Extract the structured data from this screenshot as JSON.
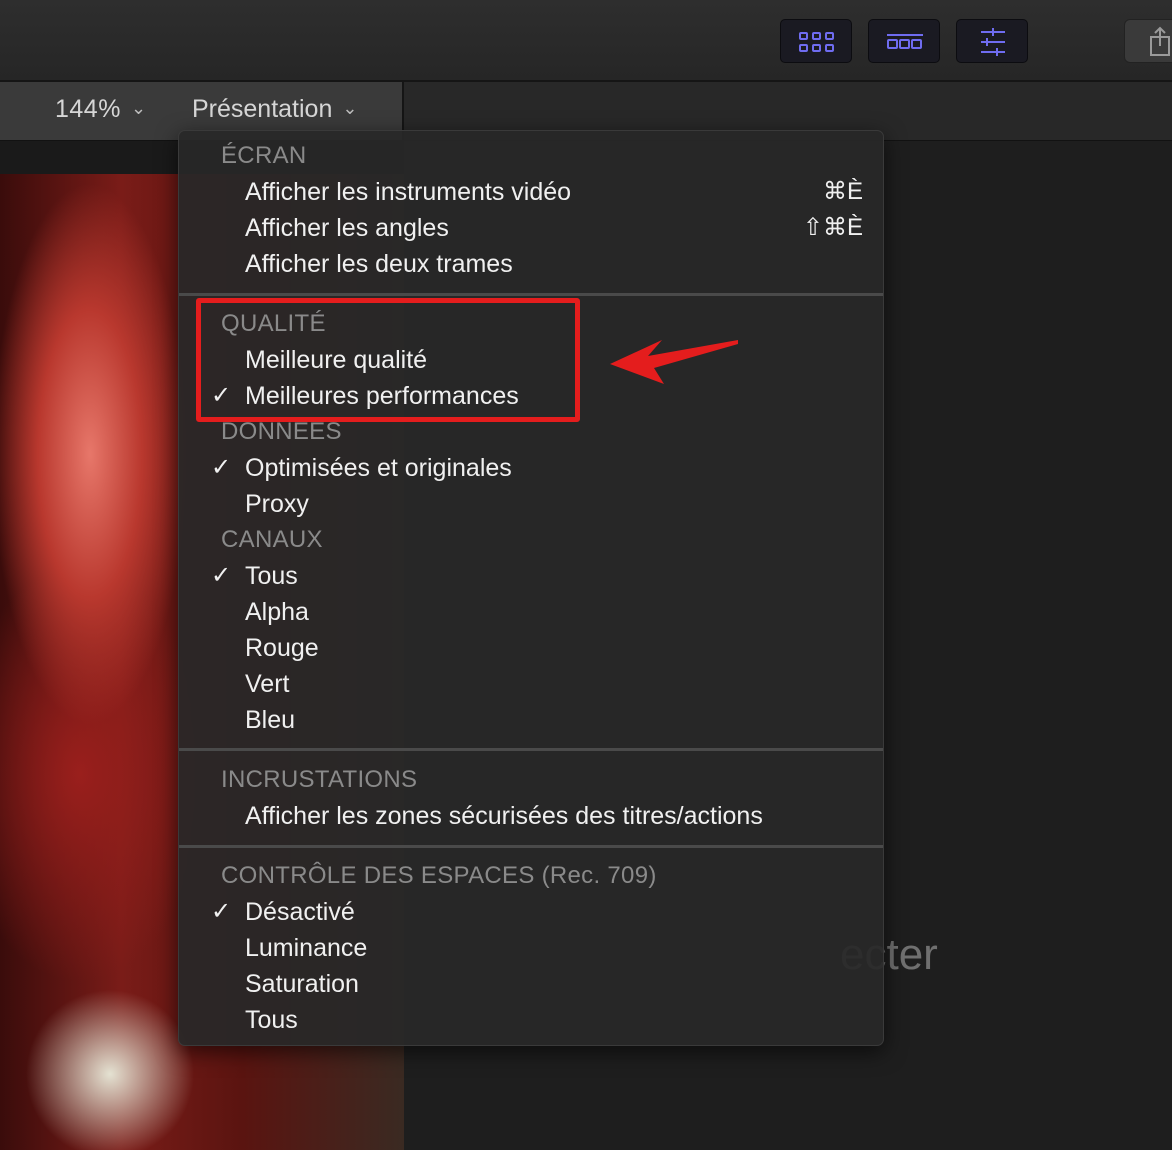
{
  "toolbar": {
    "buttons": [
      {
        "name": "browser-grid-icon"
      },
      {
        "name": "timeline-icon"
      },
      {
        "name": "inspector-sliders-icon"
      }
    ],
    "share_icon": "share-icon"
  },
  "viewer": {
    "zoom_label": "144%",
    "zoom_chevron": "⌄",
    "presentation_label": "Présentation",
    "presentation_chevron": "⌄"
  },
  "background_text": "ecter",
  "menu": {
    "sections": {
      "ecran": {
        "header": "ÉCRAN",
        "items": [
          {
            "label": "Afficher les instruments vidéo",
            "shortcut": "⌘È"
          },
          {
            "label": "Afficher les angles",
            "shortcut": "⇧⌘È"
          },
          {
            "label": "Afficher les deux trames"
          }
        ]
      },
      "qualite": {
        "header": "QUALITÉ",
        "items": [
          {
            "label": "Meilleure qualité",
            "checked": false
          },
          {
            "label": "Meilleures performances",
            "checked": true,
            "check": "✓"
          }
        ]
      },
      "donnees": {
        "header": "DONNÉES",
        "items": [
          {
            "label": "Optimisées et originales",
            "checked": true,
            "check": "✓"
          },
          {
            "label": "Proxy",
            "checked": false
          }
        ]
      },
      "canaux": {
        "header": "CANAUX",
        "items": [
          {
            "label": "Tous",
            "checked": true,
            "check": "✓"
          },
          {
            "label": "Alpha"
          },
          {
            "label": "Rouge"
          },
          {
            "label": "Vert"
          },
          {
            "label": "Bleu"
          }
        ]
      },
      "incrustations": {
        "header": "INCRUSTATIONS",
        "items": [
          {
            "label": "Afficher les zones sécurisées des titres/actions"
          }
        ]
      },
      "controle": {
        "header": "CONTRÔLE DES ESPACES (Rec. 709)",
        "items": [
          {
            "label": "Désactivé",
            "checked": true,
            "check": "✓"
          },
          {
            "label": "Luminance"
          },
          {
            "label": "Saturation"
          },
          {
            "label": "Tous"
          }
        ]
      }
    }
  },
  "annotation": {
    "highlight_color": "#e41d1d",
    "arrow_color": "#e41d1d"
  }
}
